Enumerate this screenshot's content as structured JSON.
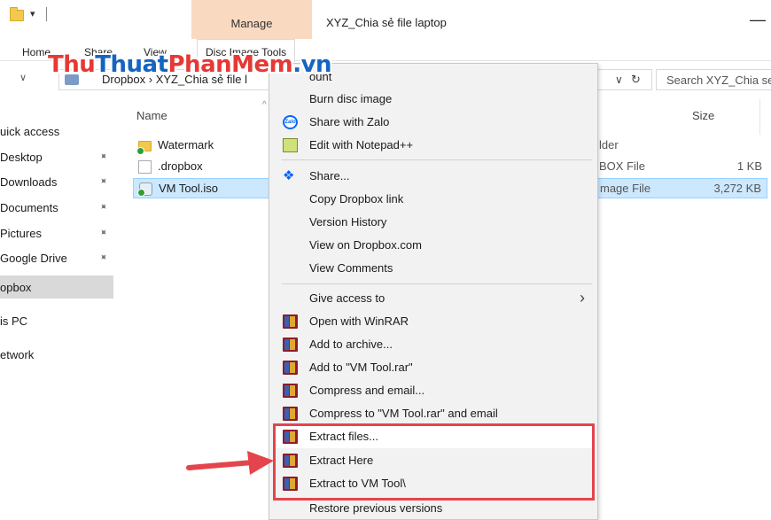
{
  "window": {
    "title": "XYZ_Chia sẻ file laptop",
    "quick_access_toolbar_dropdown": "▾",
    "contextual_tab_group": "Manage",
    "minimize_glyph": "—"
  },
  "ribbon": {
    "tabs": [
      {
        "label": "Home"
      },
      {
        "label": "Share"
      },
      {
        "label": "View"
      },
      {
        "label": "Disc Image Tools",
        "active": true
      }
    ]
  },
  "address_bar": {
    "path": "Dropbox  ›  XYZ_Chia sẻ file l",
    "dropdown_glyph": "∨",
    "refresh_glyph": "↻",
    "search_placeholder": "Search XYZ_Chia se"
  },
  "watermark": {
    "part1": "Thu",
    "part2": "Thuat",
    "part3": "PhanMem",
    "part4": ".vn"
  },
  "navigation_pane": {
    "items": [
      {
        "label": "uick access",
        "pinned": false
      },
      {
        "label": "Desktop",
        "pinned": true
      },
      {
        "label": "Downloads",
        "pinned": true
      },
      {
        "label": "Documents",
        "pinned": true
      },
      {
        "label": "Pictures",
        "pinned": true
      },
      {
        "label": "Google Drive",
        "pinned": true
      },
      {
        "label": "opbox",
        "selected": true
      },
      {
        "label": "is PC"
      },
      {
        "label": "etwork"
      }
    ],
    "pin_glyph": "📌"
  },
  "file_list": {
    "columns": {
      "name": "Name",
      "size": "Size"
    },
    "sort_glyph": "^",
    "rows": [
      {
        "name": "Watermark",
        "type": "lder",
        "size": "",
        "icon": "folder-icon"
      },
      {
        "name": ".dropbox",
        "type": "BOX File",
        "size": "1 KB",
        "icon": "file-icon"
      },
      {
        "name": "VM Tool.iso",
        "type": "mage File",
        "size": "3,272 KB",
        "icon": "disc-image-icon",
        "selected": true
      }
    ]
  },
  "context_menu": {
    "items": [
      {
        "label": "ount",
        "icon": ""
      },
      {
        "label": "Burn disc image",
        "icon": ""
      },
      {
        "label": "Share with Zalo",
        "icon": "zalo-icon"
      },
      {
        "label": "Edit with Notepad++",
        "icon": "notepad-plus-plus-icon"
      },
      {
        "label": "Share...",
        "icon": "dropbox-icon"
      },
      {
        "label": "Copy Dropbox link",
        "icon": ""
      },
      {
        "label": "Version History",
        "icon": ""
      },
      {
        "label": "View on Dropbox.com",
        "icon": ""
      },
      {
        "label": "View Comments",
        "icon": ""
      },
      {
        "label": "Give access to",
        "icon": "",
        "submenu": true
      },
      {
        "label": "Open with WinRAR",
        "icon": "winrar-icon"
      },
      {
        "label": "Add to archive...",
        "icon": "winrar-icon"
      },
      {
        "label": "Add to \"VM Tool.rar\"",
        "icon": "winrar-icon"
      },
      {
        "label": "Compress and email...",
        "icon": "winrar-icon"
      },
      {
        "label": "Compress to \"VM Tool.rar\" and email",
        "icon": "winrar-icon"
      },
      {
        "label": "Extract files...",
        "icon": "winrar-icon",
        "highlighted": true
      },
      {
        "label": "Extract Here",
        "icon": "winrar-icon"
      },
      {
        "label": "Extract to VM Tool\\",
        "icon": "winrar-icon"
      },
      {
        "label": "Restore previous versions",
        "icon": ""
      }
    ],
    "submenu_glyph": "›",
    "zalo_icon_text": "Zalo",
    "dropbox_icon_glyph": "❖"
  },
  "colors": {
    "manage_tab": "#f9d9c0",
    "selection": "#cce8ff",
    "highlight_border": "#e4444d",
    "annotation_arrow": "#e4444d"
  }
}
